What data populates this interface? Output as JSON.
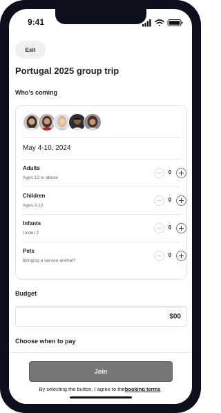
{
  "status_bar": {
    "time": "9:41"
  },
  "header": {
    "exit_label": "Exit",
    "trip_title": "Portugal  2025 group trip"
  },
  "guests": {
    "heading": "Who's coming",
    "dates": "May 4-10, 2024",
    "rows": [
      {
        "label": "Adults",
        "sub": "Ages 13 or above",
        "count": "0"
      },
      {
        "label": "Children",
        "sub": "Ages 2-12",
        "count": "0"
      },
      {
        "label": "Infants",
        "sub": "Under 2",
        "count": "0"
      },
      {
        "label": "Pets",
        "sub": "Bringing a service animal?",
        "count": "0"
      }
    ]
  },
  "budget": {
    "heading": "Budget",
    "value": "$00"
  },
  "payment": {
    "heading": "Choose when to pay"
  },
  "footer": {
    "join_label": "Join",
    "agree_text": "By selecting the button, I agree to the",
    "terms_link": "booking terms",
    "agree_suffix": "."
  },
  "colors": {
    "phone_frame": "#0d0f1c",
    "join_button": "#777777",
    "card_border": "#e3e3e3"
  },
  "icons": [
    "signal-icon",
    "wifi-icon",
    "battery-icon",
    "minus-icon",
    "plus-icon"
  ]
}
